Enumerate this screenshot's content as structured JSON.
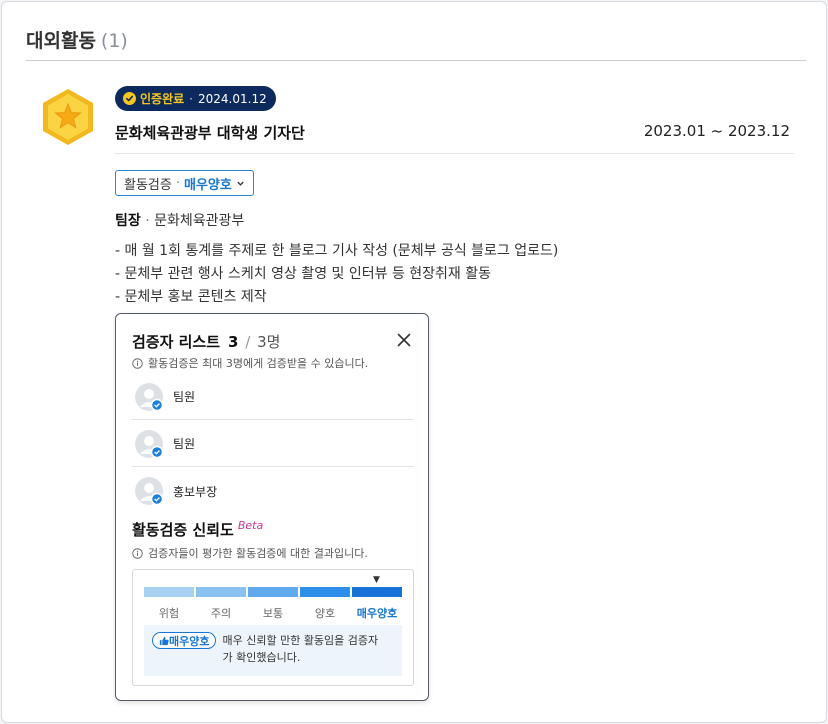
{
  "section": {
    "title": "대외활동",
    "count": "(1)"
  },
  "activity": {
    "cert_status": "인증완료",
    "cert_date": "2024.01.12",
    "title": "문화체육관광부 대학생 기자단",
    "period": "2023.01 ~ 2023.12",
    "verify_label": "활동검증",
    "verify_grade": "매우양호",
    "role": "팀장",
    "organization": "문화체육관광부",
    "descriptions": [
      "- 매 월 1회 통계를 주제로 한 블로그 기사 작성 (문체부 공식 블로그 업로드)",
      "- 문체부 관련 행사 스케치 영상 촬영 및 인터뷰 등 현장취재 활동",
      "- 문체부 홍보 콘텐츠 제작"
    ]
  },
  "popover": {
    "title": "검증자 리스트",
    "current": "3",
    "total": "3명",
    "info": "활동검증은 최대 3명에게 검증받을 수 있습니다.",
    "verifiers": [
      {
        "name": "팀원"
      },
      {
        "name": "팀원"
      },
      {
        "name": "홍보부장"
      }
    ],
    "trust": {
      "title": "활동검증 신뢰도",
      "beta": "Beta",
      "info": "검증자들이 평가한 활동검증에 대한 결과입니다.",
      "levels": [
        "위험",
        "주의",
        "보통",
        "양호",
        "매우양호"
      ],
      "level_colors": [
        "#a9d1f4",
        "#8bc1f0",
        "#5fa9ec",
        "#2d8ee8",
        "#1672d6"
      ],
      "selected_index": 4,
      "result_chip": "매우양호",
      "result_text_line1": "매우 신뢰할 만한 활동임을 검증자",
      "result_text_line2": "가 확인했습니다."
    }
  },
  "colors": {
    "navy": "#0d2a5e",
    "accent_blue": "#1877d4",
    "gold": "#f6c71a",
    "beta_pink": "#d2349a"
  }
}
